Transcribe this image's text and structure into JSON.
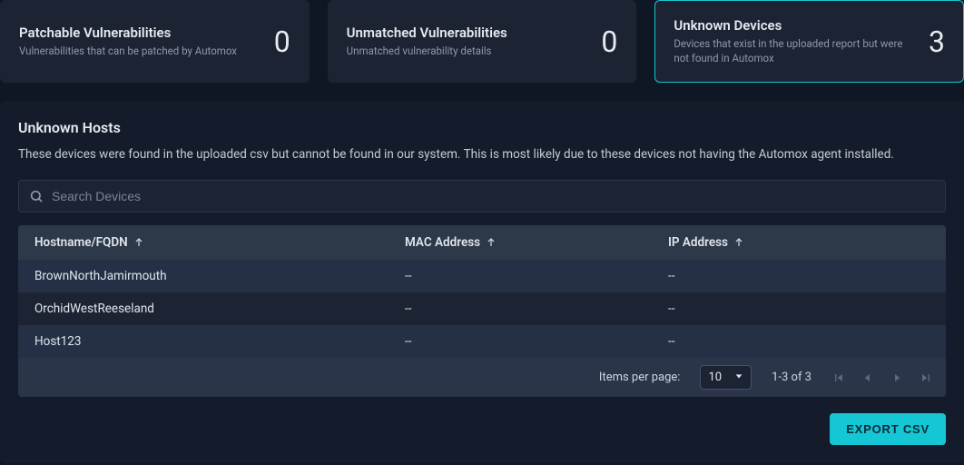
{
  "cards": {
    "patchable": {
      "title": "Patchable Vulnerabilities",
      "sub": "Vulnerabilities that can be patched by Automox",
      "value": "0"
    },
    "unmatched": {
      "title": "Unmatched Vulnerabilities",
      "sub": "Unmatched vulnerability details",
      "value": "0"
    },
    "unknown": {
      "title": "Unknown Devices",
      "sub": "Devices that exist in the uploaded report but were not found in Automox",
      "value": "3"
    }
  },
  "panel": {
    "title": "Unknown Hosts",
    "desc": "These devices were found in the uploaded csv but cannot be found in our system. This is most likely due to these devices not having the Automox agent installed.",
    "search_placeholder": "Search Devices"
  },
  "table": {
    "headers": {
      "host": "Hostname/FQDN",
      "mac": "MAC Address",
      "ip": "IP Address"
    },
    "rows": [
      {
        "host": "BrownNorthJamirmouth",
        "mac": "--",
        "ip": "--"
      },
      {
        "host": "OrchidWestReeseland",
        "mac": "--",
        "ip": "--"
      },
      {
        "host": "Host123",
        "mac": "--",
        "ip": "--"
      }
    ]
  },
  "footer": {
    "ipp_label": "Items per page:",
    "ipp_value": "10",
    "range": "1-3 of 3"
  },
  "actions": {
    "export": "EXPORT CSV"
  }
}
